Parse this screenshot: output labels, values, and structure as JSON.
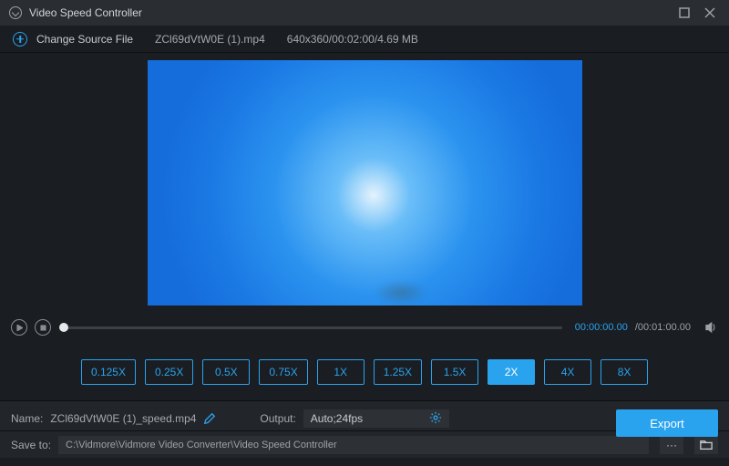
{
  "titlebar": {
    "title": "Video Speed Controller"
  },
  "source": {
    "change_label": "Change Source File",
    "file_name": "ZCl69dVtW0E (1).mp4",
    "file_meta": "640x360/00:02:00/4.69 MB"
  },
  "playback": {
    "current_time": "00:00:00.00",
    "total_time": "/00:01:00.00"
  },
  "speeds": {
    "options": [
      "0.125X",
      "0.25X",
      "0.5X",
      "0.75X",
      "1X",
      "1.25X",
      "1.5X",
      "2X",
      "4X",
      "8X"
    ],
    "active_index": 7
  },
  "name_row": {
    "label": "Name:",
    "value": "ZCl69dVtW0E (1)_speed.mp4"
  },
  "output": {
    "label": "Output:",
    "value": "Auto;24fps"
  },
  "save": {
    "label": "Save to:",
    "path": "C:\\Vidmore\\Vidmore Video Converter\\Video Speed Controller"
  },
  "export": {
    "label": "Export"
  }
}
